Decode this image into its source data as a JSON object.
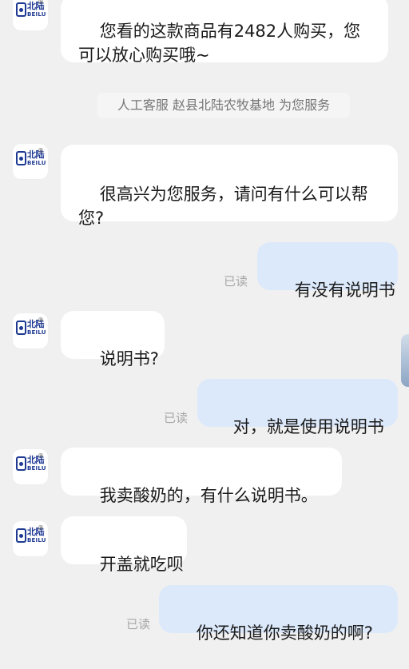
{
  "brand": {
    "name_cn": "北陆",
    "name_en": "BEILU",
    "mark": "®"
  },
  "system_notice": "人工客服 赵县北陆农牧基地 为您服务",
  "read_label": "已读",
  "messages": [
    {
      "side": "in",
      "text": "您看的这款商品有2482人购买，您可以放心购买哦~"
    },
    {
      "side": "in",
      "text": "很高兴为您服务，请问有什么可以帮您?"
    },
    {
      "side": "out",
      "text": "有没有说明书",
      "status": "已读"
    },
    {
      "side": "in",
      "text": "说明书?"
    },
    {
      "side": "out",
      "text": "对，就是使用说明书",
      "status": "已读"
    },
    {
      "side": "in",
      "text": "我卖酸奶的，有什么说明书。"
    },
    {
      "side": "in",
      "text": "开盖就吃呗"
    },
    {
      "side": "out",
      "text": "你还知道你卖酸奶的啊?",
      "status": "已读"
    }
  ],
  "colors": {
    "background": "#f0f0f0",
    "incoming_bubble": "#ffffff",
    "outgoing_bubble": "#dce9fb",
    "brand_blue": "#1f3a93",
    "read_text": "#a7a7a7"
  }
}
